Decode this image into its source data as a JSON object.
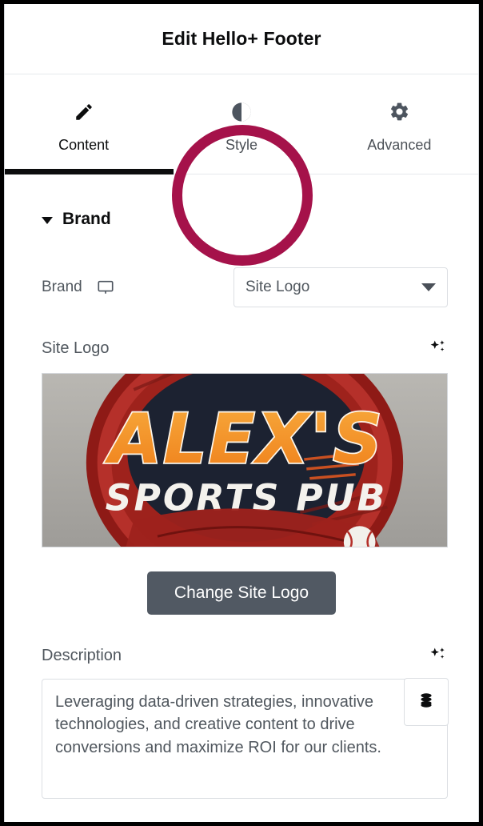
{
  "header": {
    "title": "Edit Hello+ Footer"
  },
  "tabs": [
    {
      "label": "Content",
      "icon": "pencil-icon",
      "active": true
    },
    {
      "label": "Style",
      "icon": "contrast-icon",
      "active": false
    },
    {
      "label": "Advanced",
      "icon": "gear-icon",
      "active": false
    }
  ],
  "annotation": {
    "target": "Style",
    "color": "#a5124a"
  },
  "section": {
    "title": "Brand",
    "expanded": true
  },
  "brand_row": {
    "label": "Brand",
    "device_icon": "desktop-icon",
    "select": {
      "value": "Site Logo",
      "options": [
        "Site Logo"
      ]
    }
  },
  "site_logo": {
    "label": "Site Logo",
    "ai_icon": "sparkles-icon",
    "image": {
      "alt": "Alex's Sports Pub logo",
      "line1": "ALEX'S",
      "line2": "SPORTS PUB",
      "colors": {
        "background": "#a9a7a2",
        "ring": "#b02a22",
        "ring_dark": "#8e1c17",
        "shield": "#1d2433",
        "text_primary": "#f08a22",
        "text_secondary": "#f2f0ec"
      }
    },
    "button_label": "Change Site Logo"
  },
  "description": {
    "label": "Description",
    "ai_icon": "sparkles-icon",
    "value": "Leveraging data-driven strategies, innovative technologies, and creative content to drive conversions and maximize ROI for our clients.",
    "placeholder": "",
    "side_button_icon": "database-icon"
  }
}
